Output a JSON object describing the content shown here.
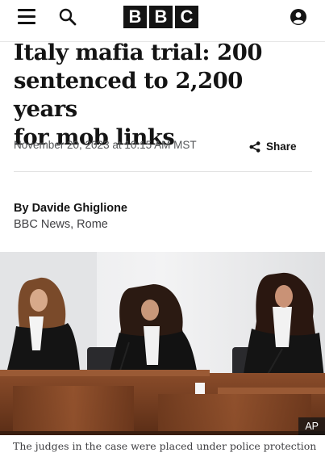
{
  "header": {
    "logo_letters": [
      "B",
      "B",
      "C"
    ],
    "icons": {
      "menu": "hamburger-menu-icon",
      "search": "search-icon",
      "account": "account-icon"
    }
  },
  "article": {
    "headline_lines": [
      "Italy mafia trial: 200",
      "sentenced to 2,200 years",
      "for mob links"
    ],
    "timestamp": "November 20, 2023 at 10:15 AM MST",
    "share_label": "Share",
    "author": "By Davide Ghiglione",
    "author_role": "BBC News, Rome"
  },
  "image": {
    "credit": "AP",
    "caption": "The judges in the case were placed under police protection"
  },
  "colors": {
    "text": "#141414",
    "secondary_text": "#545658",
    "divider": "#e3e3e3"
  }
}
